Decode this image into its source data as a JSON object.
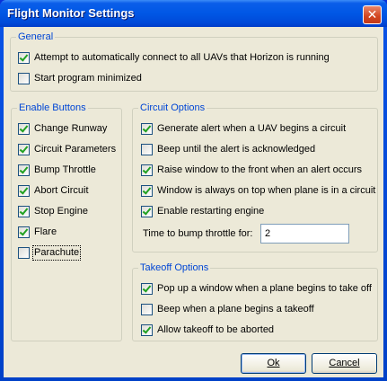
{
  "window": {
    "title": "Flight Monitor Settings",
    "close_glyph": "✕"
  },
  "general": {
    "legend": "General",
    "items": [
      {
        "label": "Attempt to automatically connect to all UAVs that Horizon is running",
        "checked": true
      },
      {
        "label": "Start program minimized",
        "checked": false
      }
    ]
  },
  "enable_buttons": {
    "legend": "Enable Buttons",
    "items": [
      {
        "label": "Change Runway",
        "checked": true
      },
      {
        "label": "Circuit Parameters",
        "checked": true
      },
      {
        "label": "Bump Throttle",
        "checked": true
      },
      {
        "label": "Abort Circuit",
        "checked": true
      },
      {
        "label": "Stop Engine",
        "checked": true
      },
      {
        "label": "Flare",
        "checked": true
      },
      {
        "label": "Parachute",
        "checked": false
      }
    ]
  },
  "circuit_options": {
    "legend": "Circuit Options",
    "items": [
      {
        "label": "Generate alert when a UAV begins a circuit",
        "checked": true
      },
      {
        "label": "Beep until the alert is acknowledged",
        "checked": false
      },
      {
        "label": "Raise window to the front when an alert occurs",
        "checked": true
      },
      {
        "label": "Window is always on top when plane is in a circuit",
        "checked": true
      },
      {
        "label": "Enable restarting engine",
        "checked": true
      }
    ],
    "bump_label": "Time to bump throttle for:",
    "bump_value": "2"
  },
  "takeoff_options": {
    "legend": "Takeoff Options",
    "items": [
      {
        "label": "Pop up a window when a plane begins to take off",
        "checked": true
      },
      {
        "label": "Beep when a plane begins a takeoff",
        "checked": false
      },
      {
        "label": "Allow takeoff to be aborted",
        "checked": true
      }
    ]
  },
  "buttons": {
    "ok": "Ok",
    "cancel": "Cancel"
  }
}
